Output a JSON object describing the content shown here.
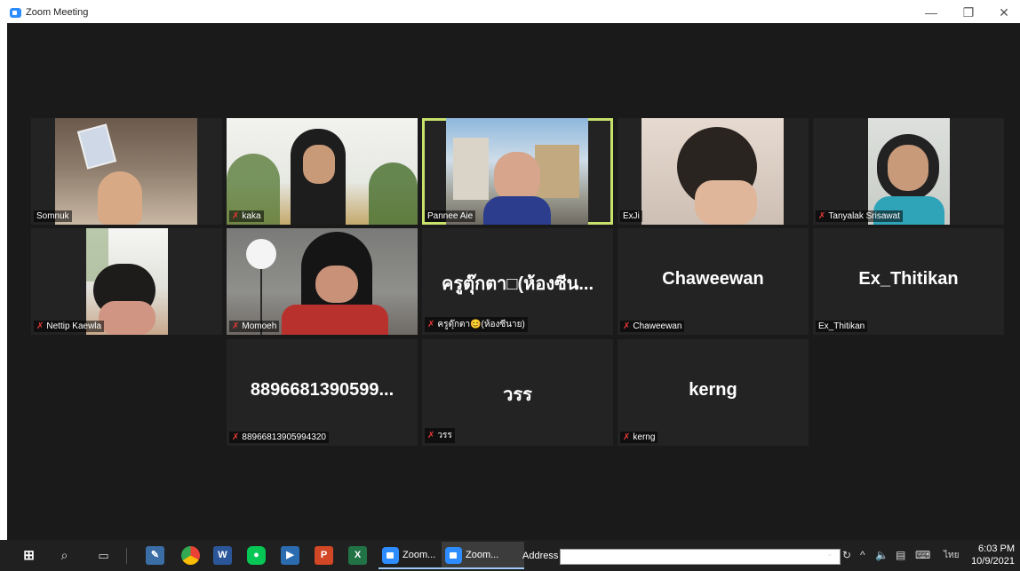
{
  "window": {
    "title": "Zoom Meeting",
    "minimize": "—",
    "restore": "❐",
    "close": "✕"
  },
  "active_speaker": "Pannee Aie",
  "participants": [
    {
      "id": "somnuk",
      "label": "Somnuk",
      "muted": false,
      "video": true,
      "display_name": ""
    },
    {
      "id": "kaka",
      "label": "kaka",
      "muted": true,
      "video": true,
      "display_name": ""
    },
    {
      "id": "pannee",
      "label": "Pannee Aie",
      "muted": false,
      "video": true,
      "display_name": ""
    },
    {
      "id": "exji",
      "label": "ExJi",
      "muted": false,
      "video": true,
      "display_name": ""
    },
    {
      "id": "tanyalak",
      "label": "Tanyalak Srisawat",
      "muted": true,
      "video": true,
      "display_name": ""
    },
    {
      "id": "nettip",
      "label": "Nettip Kaewla",
      "muted": true,
      "video": true,
      "display_name": ""
    },
    {
      "id": "momoeh",
      "label": "Momoeh",
      "muted": true,
      "video": true,
      "display_name": ""
    },
    {
      "id": "krutukta",
      "label": "ครูตุ๊กตา😊(ห้องซีนาย)",
      "muted": true,
      "video": false,
      "display_name": "ครูตุ๊กตา□(ห้องซีน..."
    },
    {
      "id": "chaweewan",
      "label": "Chaweewan",
      "muted": true,
      "video": false,
      "display_name": "Chaweewan"
    },
    {
      "id": "exthitikan",
      "label": "Ex_Thitikan",
      "muted": false,
      "video": false,
      "display_name": "Ex_Thitikan"
    },
    {
      "id": "phone",
      "label": "88966813905994320",
      "muted": true,
      "video": false,
      "display_name": "8896681390599..."
    },
    {
      "id": "worr",
      "label": "วรร",
      "muted": true,
      "video": false,
      "display_name": "วรร"
    },
    {
      "id": "kerng",
      "label": "kerng",
      "muted": true,
      "video": false,
      "display_name": "kerng"
    }
  ],
  "taskbar": {
    "zoom_tasks": [
      "Zoom...",
      "Zoom..."
    ],
    "address_label": "Address",
    "address_value": "",
    "language": "ไทย",
    "time": "6:03 PM",
    "date": "10/9/2021"
  },
  "colors": {
    "accent": "#2D8CFF",
    "active_border": "#c8e26c",
    "muted_icon": "#e53935"
  }
}
